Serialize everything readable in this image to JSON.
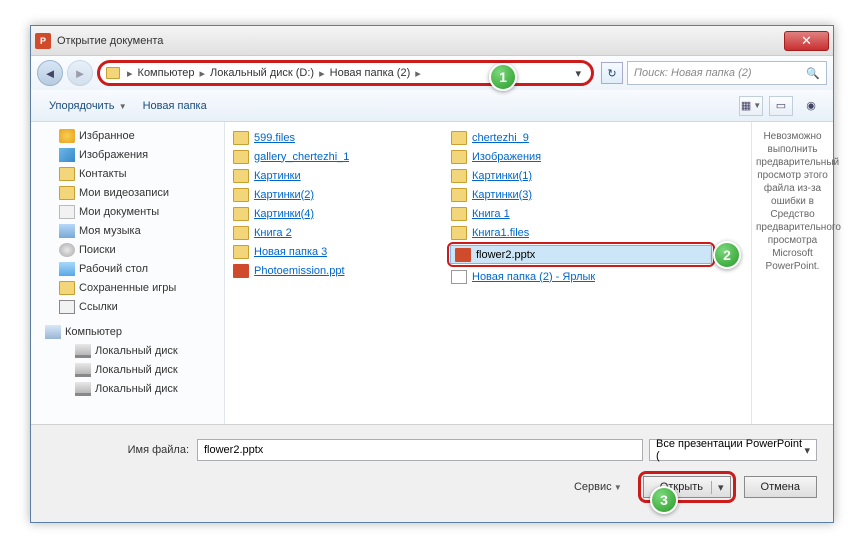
{
  "window": {
    "title": "Открытие документа"
  },
  "breadcrumb": {
    "seg1": "Компьютер",
    "seg2": "Локальный диск (D:)",
    "seg3": "Новая папка (2)"
  },
  "search": {
    "placeholder": "Поиск: Новая папка (2)"
  },
  "toolbar": {
    "organize": "Упорядочить",
    "newfolder": "Новая папка"
  },
  "tree": {
    "fav": "Избранное",
    "pics": "Изображения",
    "contacts": "Контакты",
    "videos": "Мои видеозаписи",
    "docs": "Мои документы",
    "music": "Моя музыка",
    "searches": "Поиски",
    "desktop": "Рабочий стол",
    "saved": "Сохраненные игры",
    "links": "Ссылки",
    "computer": "Компьютер",
    "drive1": "Локальный диск",
    "drive2": "Локальный диск",
    "drive3": "Локальный диск"
  },
  "files": {
    "col1": [
      "599.files",
      "gallery_chertezhi_1",
      "Картинки",
      "Картинки(2)",
      "Картинки(4)",
      "Книга 2",
      "Новая папка 3",
      "Photoemission.ppt"
    ],
    "col2": [
      "chertezhi_9",
      "Изображения",
      "Картинки(1)",
      "Картинки(3)",
      "Книга 1",
      "Книга1.files",
      "flower2.pptx",
      "Новая папка (2) - Ярлык"
    ]
  },
  "preview": "Невозможно выполнить предварительный просмотр этого файла из-за ошибки в Средство предварительного просмотра Microsoft PowerPoint.",
  "bottom": {
    "filename_label": "Имя файла:",
    "filename_value": "flower2.pptx",
    "filetype": "Все презентации PowerPoint (",
    "service": "Сервис",
    "open": "Открыть",
    "cancel": "Отмена"
  },
  "callouts": {
    "one": "1",
    "two": "2",
    "three": "3"
  }
}
